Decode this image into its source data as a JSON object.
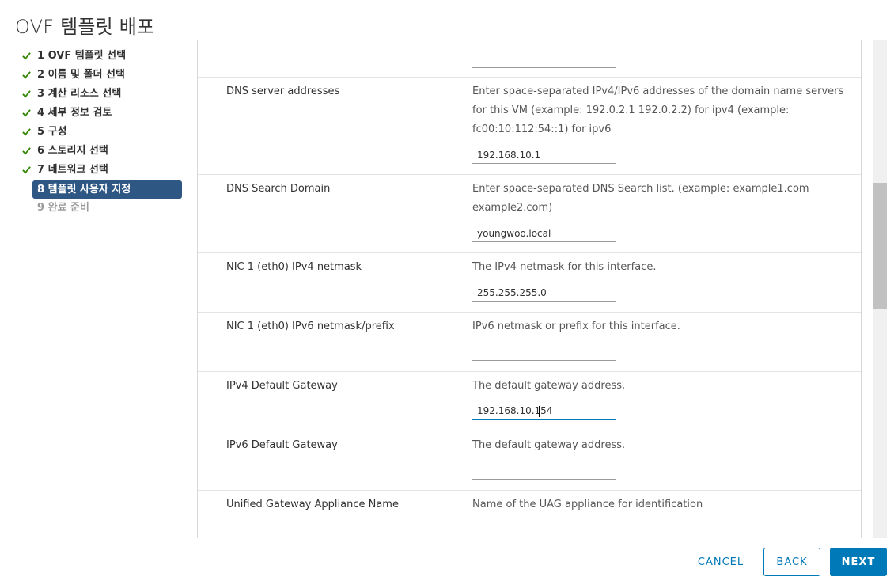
{
  "dialog": {
    "title": "OVF 템플릿 배포"
  },
  "steps": [
    {
      "label": "1 OVF 템플릿 선택",
      "state": "done"
    },
    {
      "label": "2 이름 및 폴더 선택",
      "state": "done"
    },
    {
      "label": "3 계산 리소스 선택",
      "state": "done"
    },
    {
      "label": "4 세부 정보 검토",
      "state": "done"
    },
    {
      "label": "5 구성",
      "state": "done"
    },
    {
      "label": "6 스토리지 선택",
      "state": "done"
    },
    {
      "label": "7 네트워크 선택",
      "state": "done"
    },
    {
      "label": "8 템플릿 사용자 지정",
      "state": "active"
    },
    {
      "label": "9 완료 준비",
      "state": "disabled"
    }
  ],
  "form": {
    "top_input_value": "",
    "dns_servers": {
      "label": "DNS server addresses",
      "description": "Enter space-separated IPv4/IPv6 addresses of the domain name servers for this VM (example:  192.0.2.1 192.0.2.2) for ipv4 (example: fc00:10:112:54::1) for ipv6",
      "value": "192.168.10.1"
    },
    "dns_search": {
      "label": "DNS Search Domain",
      "description": "Enter space-separated DNS Search list. (example:  example1.com example2.com)",
      "value": "youngwoo.local"
    },
    "ipv4_netmask": {
      "label": "NIC 1 (eth0) IPv4 netmask",
      "description": "The IPv4 netmask for this interface.",
      "value": "255.255.255.0"
    },
    "ipv6_netmask": {
      "label": "NIC 1 (eth0) IPv6 netmask/prefix",
      "description": "IPv6 netmask or prefix for this interface.",
      "value": ""
    },
    "ipv4_gateway": {
      "label": "IPv4 Default Gateway",
      "description": "The default gateway address.",
      "value": "192.168.10.154"
    },
    "ipv6_gateway": {
      "label": "IPv6 Default Gateway",
      "description": "The default gateway address.",
      "value": ""
    },
    "uag_name": {
      "label": "Unified Gateway Appliance Name",
      "description": "Name of the UAG appliance for identification"
    }
  },
  "footer": {
    "cancel": "CANCEL",
    "back": "BACK",
    "next": "NEXT"
  },
  "colors": {
    "accent": "#0079b8",
    "active_step": "#2e5784",
    "check": "#2f8400"
  }
}
